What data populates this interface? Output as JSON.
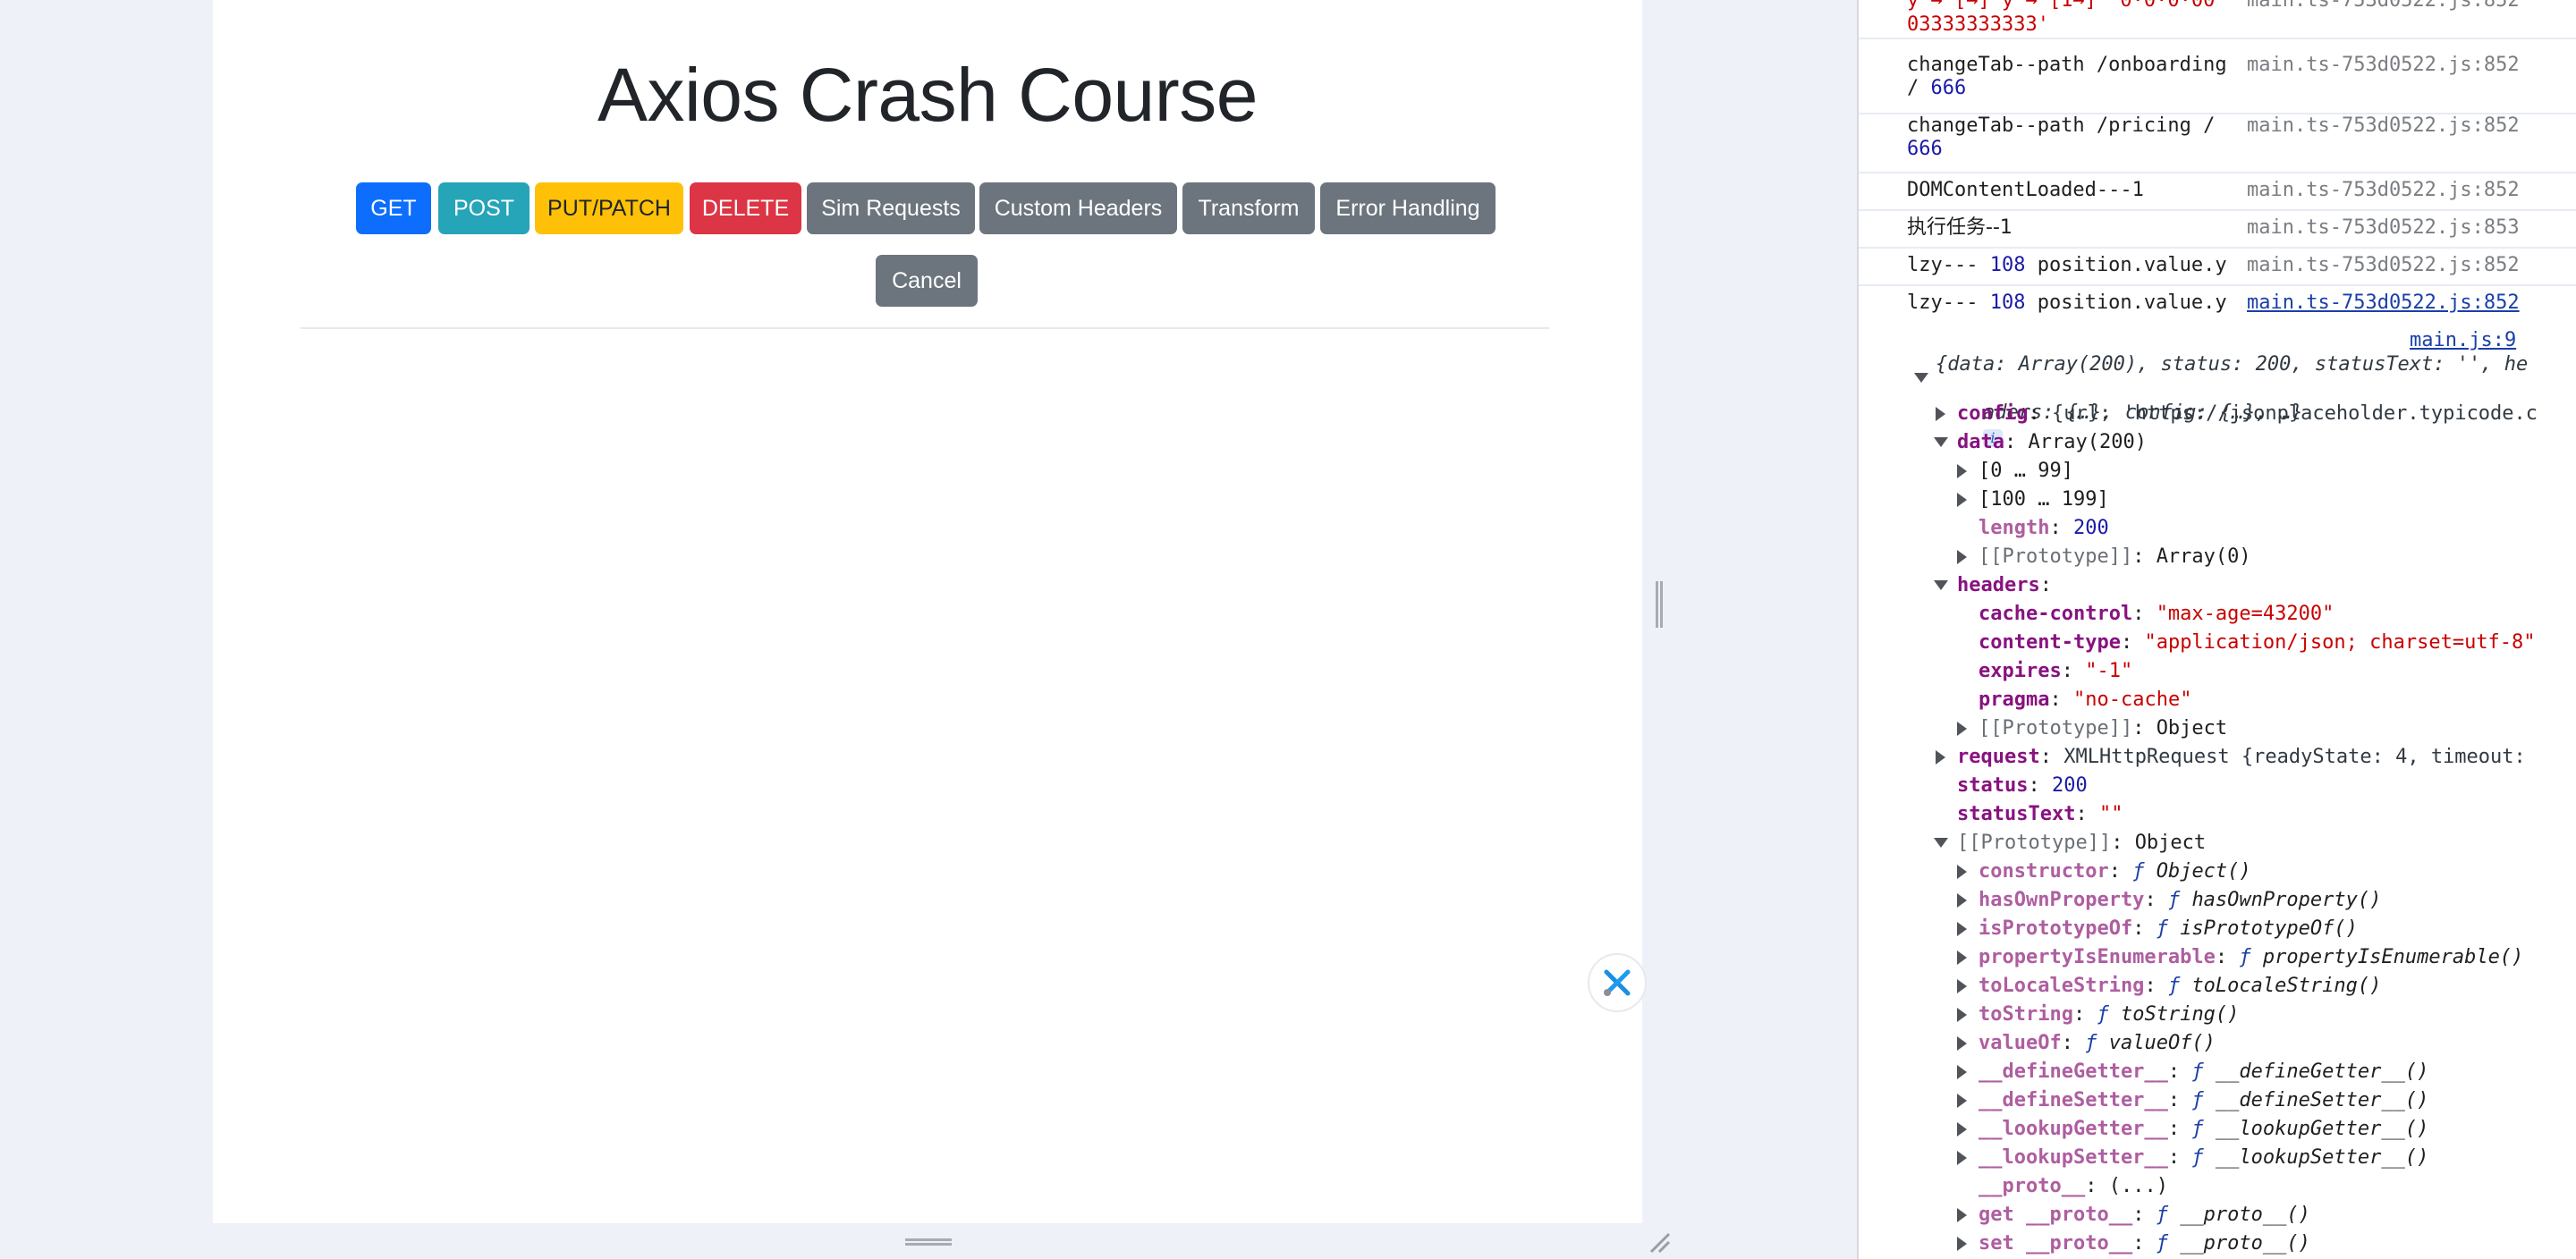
{
  "page": {
    "title": "Axios Crash Course",
    "buttons": [
      {
        "label": "GET",
        "style": "primary"
      },
      {
        "label": "POST",
        "style": "info"
      },
      {
        "label": "PUT/PATCH",
        "style": "warning"
      },
      {
        "label": "DELETE",
        "style": "danger"
      },
      {
        "label": "Sim Requests",
        "style": "secondary"
      },
      {
        "label": "Custom Headers",
        "style": "secondary"
      },
      {
        "label": "Transform",
        "style": "secondary"
      },
      {
        "label": "Error Handling",
        "style": "secondary"
      }
    ],
    "cancel_label": "Cancel"
  },
  "console": {
    "top_partial": {
      "text": "y → [→] y → [1→] ‘0·0·0·00",
      "cont": "03333333333'",
      "source": "main.ts-753d0522.js:852"
    },
    "logs": [
      {
        "msg1": "changeTab--path /onboarding",
        "msg2": "/ ",
        "num": "666",
        "source": "main.ts-753d0522.js:852"
      },
      {
        "msg1": "changeTab--path /pricing /",
        "msg2": "",
        "num": "666",
        "source": "main.ts-753d0522.js:852"
      },
      {
        "msg1": "DOMContentLoaded---1",
        "source": "main.ts-753d0522.js:852"
      },
      {
        "msg1": "执行任务--1",
        "source": "main.ts-753d0522.js:853"
      },
      {
        "prefix": "lzy--- ",
        "num": "108",
        "suffix": " position.value.y",
        "source": "main.ts-753d0522.js:852"
      },
      {
        "prefix": "lzy--- ",
        "num": "108",
        "suffix": " position.value.y",
        "source": "main.ts-753d0522.js:852"
      }
    ],
    "object_log": {
      "source": "main.js:9",
      "summary_line1": "{data: Array(200), status: 200, statusText: '', he",
      "summary_line2": "aders: {…}, config: {…}, …}",
      "info_badge": "i",
      "config": {
        "key": "config",
        "value": "{url: 'https://jsonplaceholder.typicode.c"
      },
      "data": {
        "key": "data",
        "value": "Array(200)"
      },
      "data_children": [
        {
          "label": "[0 … 99]"
        },
        {
          "label": "[100 … 199]"
        }
      ],
      "length": {
        "key": "length",
        "value": "200"
      },
      "data_proto": {
        "key": "[[Prototype]]",
        "value": "Array(0)"
      },
      "headers": {
        "key": "headers"
      },
      "header_entries": [
        {
          "key": "cache-control",
          "value": "\"max-age=43200\""
        },
        {
          "key": "content-type",
          "value": "\"application/json; charset=utf-8\""
        },
        {
          "key": "expires",
          "value": "\"-1\""
        },
        {
          "key": "pragma",
          "value": "\"no-cache\""
        }
      ],
      "headers_proto": {
        "key": "[[Prototype]]",
        "value": "Object"
      },
      "request": {
        "key": "request",
        "value": "XMLHttpRequest {readyState: 4, timeout:"
      },
      "status": {
        "key": "status",
        "value": "200"
      },
      "statusText": {
        "key": "statusText",
        "value": "\"\""
      },
      "proto": {
        "key": "[[Prototype]]",
        "value": "Object"
      },
      "proto_entries": [
        {
          "key": "constructor",
          "value": "Object()"
        },
        {
          "key": "hasOwnProperty",
          "value": "hasOwnProperty()"
        },
        {
          "key": "isPrototypeOf",
          "value": "isPrototypeOf()"
        },
        {
          "key": "propertyIsEnumerable",
          "value": "propertyIsEnumerable()"
        },
        {
          "key": "toLocaleString",
          "value": "toLocaleString()"
        },
        {
          "key": "toString",
          "value": "toString()"
        },
        {
          "key": "valueOf",
          "value": "valueOf()"
        },
        {
          "key": "__defineGetter__",
          "value": "__defineGetter__()"
        },
        {
          "key": "__defineSetter__",
          "value": "__defineSetter__()"
        },
        {
          "key": "__lookupGetter__",
          "value": "__lookupGetter__()"
        },
        {
          "key": "__lookupSetter__",
          "value": "__lookupSetter__()"
        }
      ],
      "proto_getter": {
        "key": "__proto__",
        "value": "(...)"
      },
      "get_proto": {
        "key": "get __proto__",
        "value": "__proto__()"
      },
      "set_proto": {
        "key": "set __proto__",
        "value": "__proto__()"
      },
      "fn_glyph": "ƒ"
    }
  },
  "colors": {
    "primary": "#0d6efd",
    "info": "#26a4b8",
    "warning": "#ffc107",
    "danger": "#dc3545",
    "secondary": "#6c757d"
  }
}
